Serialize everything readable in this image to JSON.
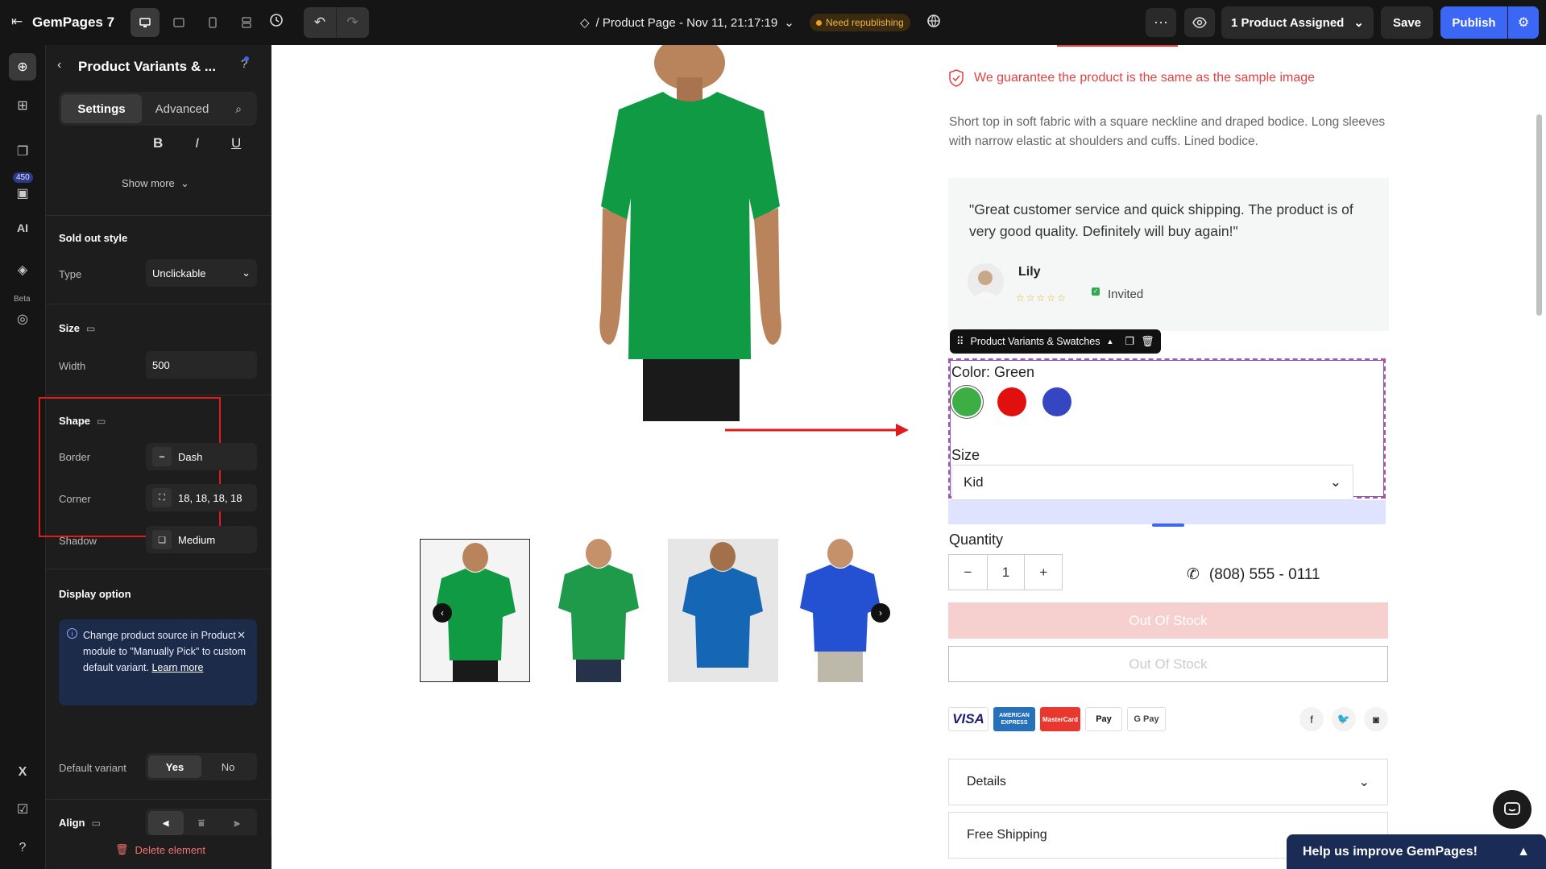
{
  "topbar": {
    "logo": "GemPages 7",
    "page_title": "/ Product Page - Nov 11, 21:17:19",
    "status_badge": "Need republishing",
    "assigned_label": "1 Product Assigned",
    "save_label": "Save",
    "publish_label": "Publish"
  },
  "rail": {
    "badge": "450",
    "beta": "Beta"
  },
  "panel": {
    "title": "Product Variants & ...",
    "tabs": [
      "Settings",
      "Advanced"
    ],
    "text_style": [
      "B",
      "I",
      "U"
    ],
    "show_more": "Show more",
    "sold_out": {
      "heading": "Sold out style",
      "type_label": "Type",
      "type_value": "Unclickable"
    },
    "size": {
      "heading": "Size",
      "width_label": "Width",
      "width_value": "500"
    },
    "shape": {
      "heading": "Shape",
      "border_label": "Border",
      "border_value": "Dash",
      "corner_label": "Corner",
      "corner_value": "18, 18, 18, 18",
      "shadow_label": "Shadow",
      "shadow_value": "Medium"
    },
    "display": {
      "heading": "Display option",
      "info_text": "Change product source in Product module to \"Manually Pick\" to custom default variant.",
      "info_link": "Learn more",
      "default_label": "Default variant",
      "yes": "Yes",
      "no": "No"
    },
    "align_heading": "Align",
    "delete_label": "Delete element"
  },
  "canvas": {
    "guarantee": "We guarantee the product is the same as the sample image",
    "description": "Short top in soft fabric with a square neckline and draped bodice. Long sleeves with narrow elastic at shoulders and cuffs. Lined bodice.",
    "review": {
      "quote": "\"Great customer service and quick shipping. The product is of very good quality. Definitely will buy again!\"",
      "name": "Lily",
      "stars": "☆☆☆☆☆",
      "status": "Invited"
    },
    "element_tag": "Product Variants & Swatches",
    "variants": {
      "color_label": "Color: Green",
      "swatches": [
        {
          "name": "Green",
          "color": "#3cae44"
        },
        {
          "name": "Red",
          "color": "#e20f0f"
        },
        {
          "name": "Blue",
          "color": "#3446c2"
        }
      ],
      "size_label": "Size",
      "size_value": "Kid"
    },
    "quantity_label": "Quantity",
    "quantity_value": "1",
    "phone": "(808) 555 - 0111",
    "oos_primary": "Out Of Stock",
    "oos_secondary": "Out Of Stock",
    "payments": [
      "VISA",
      "AMERICAN EXPRESS",
      "MasterCard",
      " Pay",
      "G Pay"
    ],
    "accordions": [
      "Details",
      "Free Shipping"
    ],
    "help_banner": "Help us improve GemPages!"
  },
  "colors": {
    "accent": "#3c67f5",
    "highlight": "#e01b1b",
    "oos_fill": "#f6cfcf",
    "guarantee": "#e04141"
  }
}
